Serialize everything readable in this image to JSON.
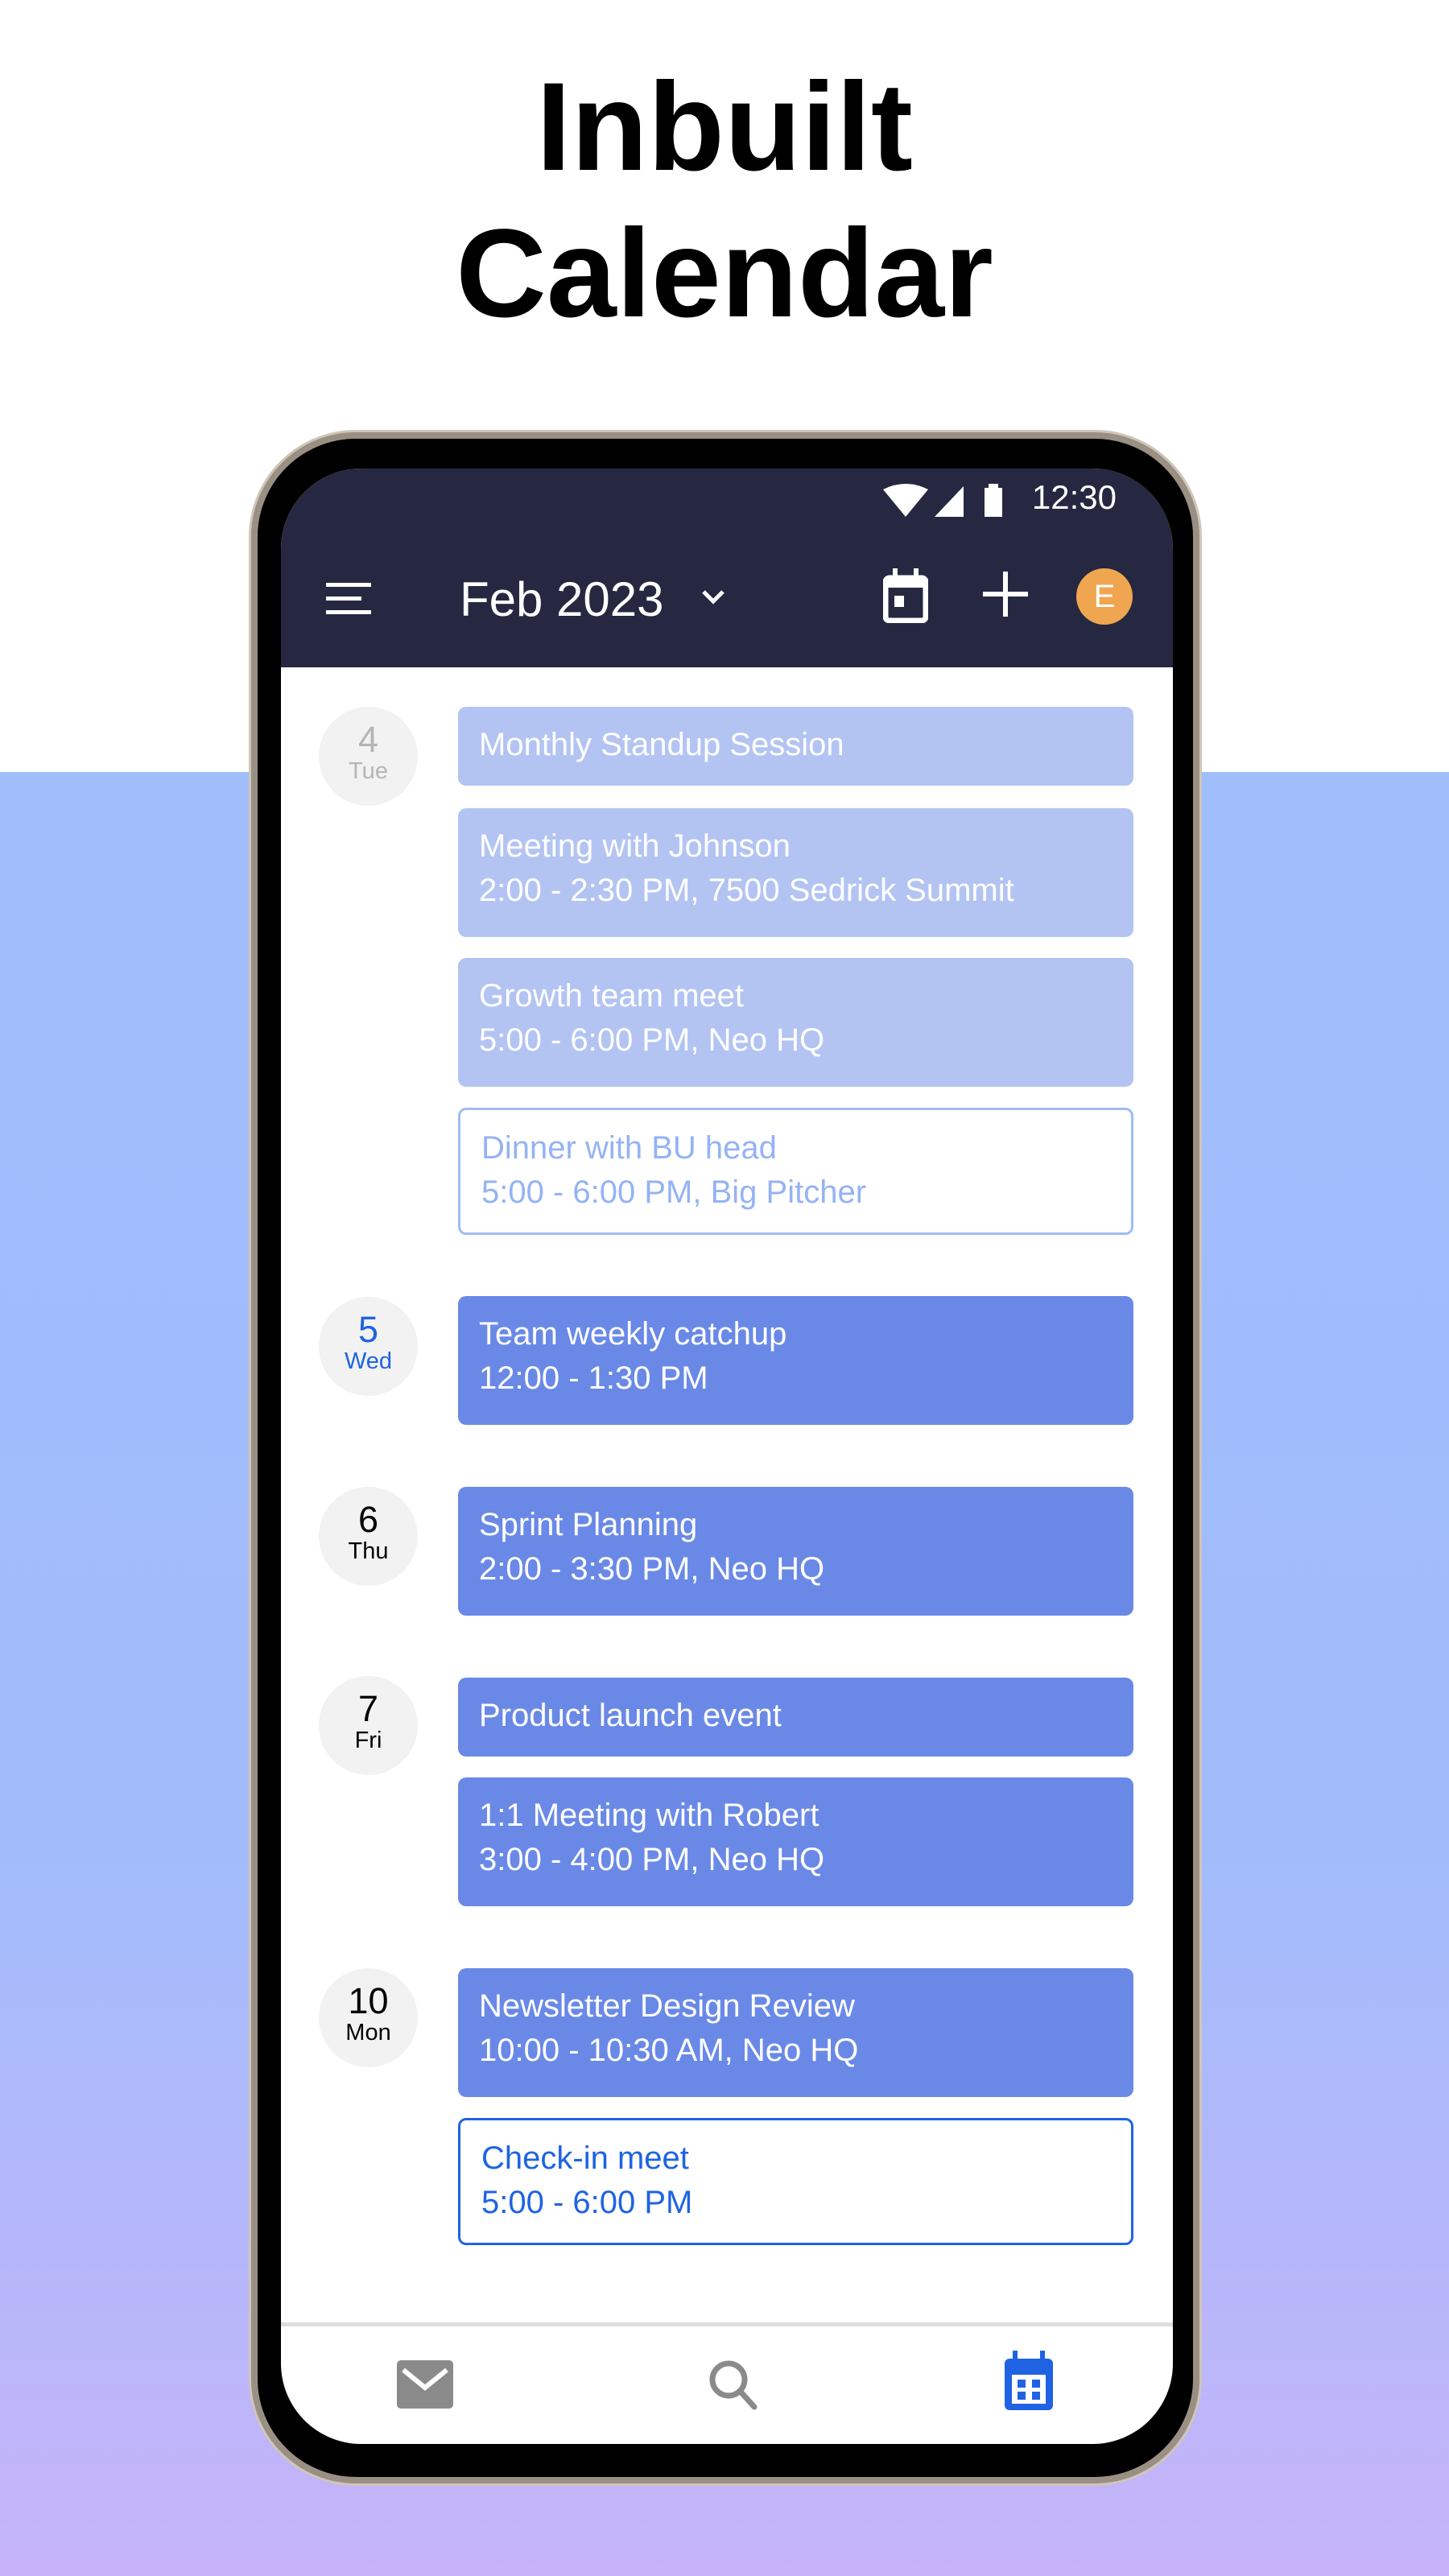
{
  "headline": {
    "line1": "Inbuilt",
    "line2": "Calendar"
  },
  "status_bar": {
    "time": "12:30",
    "icons": [
      "wifi-icon",
      "signal-icon",
      "battery-icon"
    ]
  },
  "toolbar": {
    "menu_icon": "menu-icon",
    "month": "Feb 2023",
    "today_icon": "calendar-today-icon",
    "add_icon": "plus-icon",
    "avatar_letter": "E",
    "avatar_color": "#f0a650"
  },
  "days": [
    {
      "num": "4",
      "weekday": "Tue",
      "state": "past",
      "events": [
        {
          "title": "Monthly Standup Session",
          "style": "light"
        },
        {
          "title": "Meeting with Johnson",
          "subtitle": "2:00 - 2:30 PM, 7500 Sedrick Summit",
          "style": "light"
        },
        {
          "title": "Growth team meet",
          "subtitle": "5:00 - 6:00 PM, Neo HQ",
          "style": "light"
        },
        {
          "title": "Dinner with BU head",
          "subtitle": "5:00 - 6:00 PM, Big Pitcher",
          "style": "outline-light"
        }
      ]
    },
    {
      "num": "5",
      "weekday": "Wed",
      "state": "today",
      "events": [
        {
          "title": "Team weekly catchup",
          "subtitle": "12:00 - 1:30 PM",
          "style": "dark"
        }
      ]
    },
    {
      "num": "6",
      "weekday": "Thu",
      "events": [
        {
          "title": "Sprint Planning",
          "subtitle": "2:00 - 3:30 PM, Neo HQ",
          "style": "dark"
        }
      ]
    },
    {
      "num": "7",
      "weekday": "Fri",
      "events": [
        {
          "title": "Product launch event",
          "style": "dark"
        },
        {
          "title": "1:1 Meeting with Robert",
          "subtitle": "3:00 - 4:00 PM, Neo HQ",
          "style": "dark"
        }
      ]
    },
    {
      "num": "10",
      "weekday": "Mon",
      "events": [
        {
          "title": "Newsletter Design Review",
          "subtitle": "10:00 - 10:30 AM, Neo HQ",
          "style": "dark"
        },
        {
          "title": "Check-in meet",
          "subtitle": "5:00 - 6:00 PM",
          "style": "outline-blue"
        }
      ]
    }
  ],
  "bottom_nav": [
    {
      "icon": "mail-icon"
    },
    {
      "icon": "search-icon"
    },
    {
      "icon": "calendar-icon",
      "active": true
    }
  ],
  "colors": {
    "appbar": "#252840",
    "event_light": "#b3c4f3",
    "event_dark": "#6a89e7",
    "accent": "#1f63e3",
    "inactive_icon": "#8a8a8a"
  }
}
